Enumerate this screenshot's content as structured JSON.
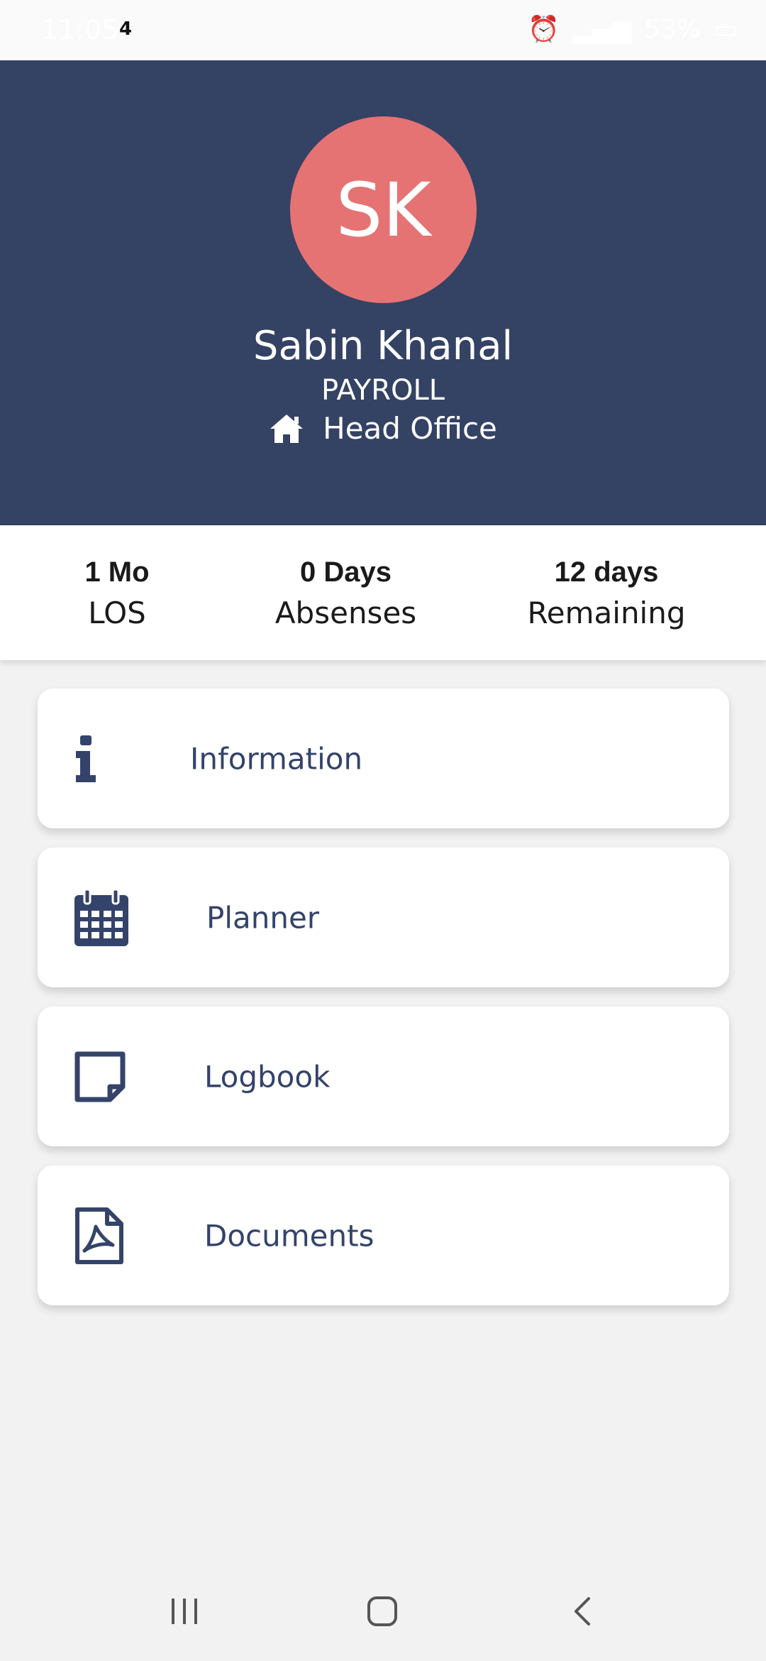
{
  "status_bar": {
    "time": "11:05",
    "notification_count": "4",
    "battery": "53%"
  },
  "profile": {
    "initials": "SK",
    "name": "Sabin Khanal",
    "role": "PAYROLL",
    "office": "Head Office",
    "avatar_color": "#e57373",
    "header_color": "#344264"
  },
  "stats": [
    {
      "value": "1 Mo",
      "label": "LOS"
    },
    {
      "value": "0 Days",
      "label": "Absenses"
    },
    {
      "value": "12 days",
      "label": "Remaining"
    }
  ],
  "menu": [
    {
      "label": "Information",
      "icon": "info-icon"
    },
    {
      "label": "Planner",
      "icon": "calendar-icon"
    },
    {
      "label": "Logbook",
      "icon": "sticky-note-icon"
    },
    {
      "label": "Documents",
      "icon": "pdf-file-icon"
    }
  ],
  "nav_bar": {
    "icons": [
      "recent-apps-icon",
      "home-button-icon",
      "back-icon"
    ]
  }
}
